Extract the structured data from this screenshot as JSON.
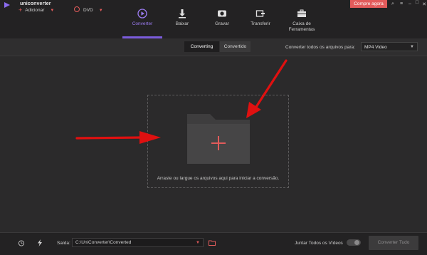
{
  "app": {
    "name": "uniconverter",
    "buy_label": "Compre agora"
  },
  "window_controls": [
    "search-icon",
    "menu-icon",
    "minimize-icon",
    "maximize-icon",
    "close-icon"
  ],
  "nav": [
    {
      "label": "Converter",
      "icon": "play-circle-icon",
      "active": true
    },
    {
      "label": "Baixar",
      "icon": "download-icon",
      "active": false
    },
    {
      "label": "Gravar",
      "icon": "record-icon",
      "active": false
    },
    {
      "label": "Transferir",
      "icon": "transfer-icon",
      "active": false
    },
    {
      "label": "Caixa de Ferramentas",
      "icon": "toolbox-icon",
      "active": false
    }
  ],
  "toolbar": {
    "add_label": "Adicionar",
    "dvd_label": "DVD",
    "tab_converting": "Converting",
    "tab_converted": "Convertido",
    "convert_all_to_label": "Converter todos os arquivos para:",
    "format_value": "MP4 Video"
  },
  "main": {
    "drop_text": "Arraste ou largue os arquivos aqui para iniciar a conversão."
  },
  "status": {
    "output_label": "Saída:",
    "output_path": "C:\\UniConverter\\Converted",
    "merge_label": "Juntar Todos os Vídeos",
    "merge_enabled": false,
    "convert_all_label": "Converter Tudo"
  },
  "colors": {
    "accent": "#7a5cdb",
    "brand_red": "#e25b5b",
    "arrow_red": "#e01010"
  }
}
